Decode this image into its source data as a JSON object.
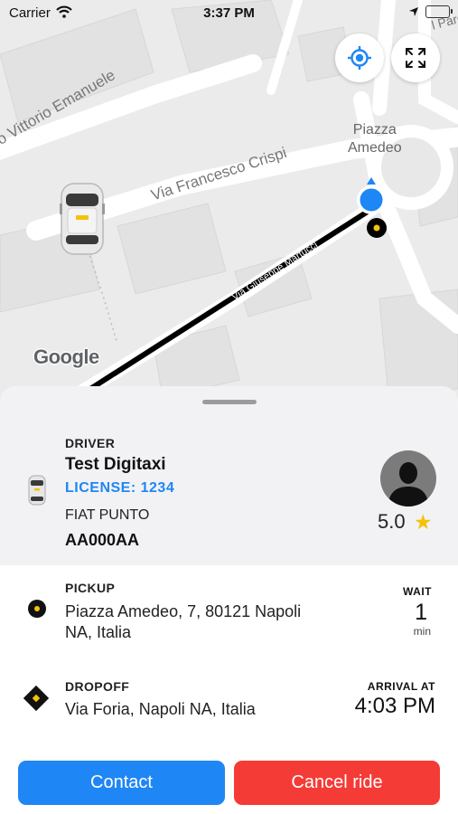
{
  "status_bar": {
    "carrier": "Carrier",
    "time": "3:37 PM"
  },
  "map": {
    "streets": {
      "vittorio_emanuele": "o Vittorio Emanuele",
      "francesco_crispi": "Via Francesco Crispi",
      "giuseppe_martucci": "Via Giuseppe Martucci",
      "parco": "l Parc"
    },
    "place": {
      "line1": "Piazza",
      "line2": "Amedeo"
    },
    "attribution": "Google",
    "route_color": "#000000",
    "user_location_color": "#1f86f5"
  },
  "driver": {
    "section_label": "DRIVER",
    "name": "Test Digitaxi",
    "license": "LICENSE: 1234",
    "car_model": "FIAT PUNTO",
    "plate": "AA000AA",
    "rating": "5.0",
    "icons": [
      "taxi-icon",
      "avatar-icon",
      "star-icon"
    ]
  },
  "pickup": {
    "label": "PICKUP",
    "address_line1": "Piazza Amedeo, 7, 80121 Napoli",
    "address_line2": "NA, Italia",
    "wait_label": "WAIT",
    "wait_value": "1",
    "wait_unit": "min"
  },
  "dropoff": {
    "label": "DROPOFF",
    "address": "Via Foria, Napoli NA, Italia",
    "arrival_label": "ARRIVAL AT",
    "arrival_time": "4:03 PM"
  },
  "actions": {
    "contact": "Contact",
    "cancel": "Cancel ride"
  },
  "colors": {
    "accent_blue": "#1f86f5",
    "danger_red": "#f53b36",
    "taxi_yellow": "#f5c20a",
    "sheet_gray": "#f2f2f4"
  }
}
